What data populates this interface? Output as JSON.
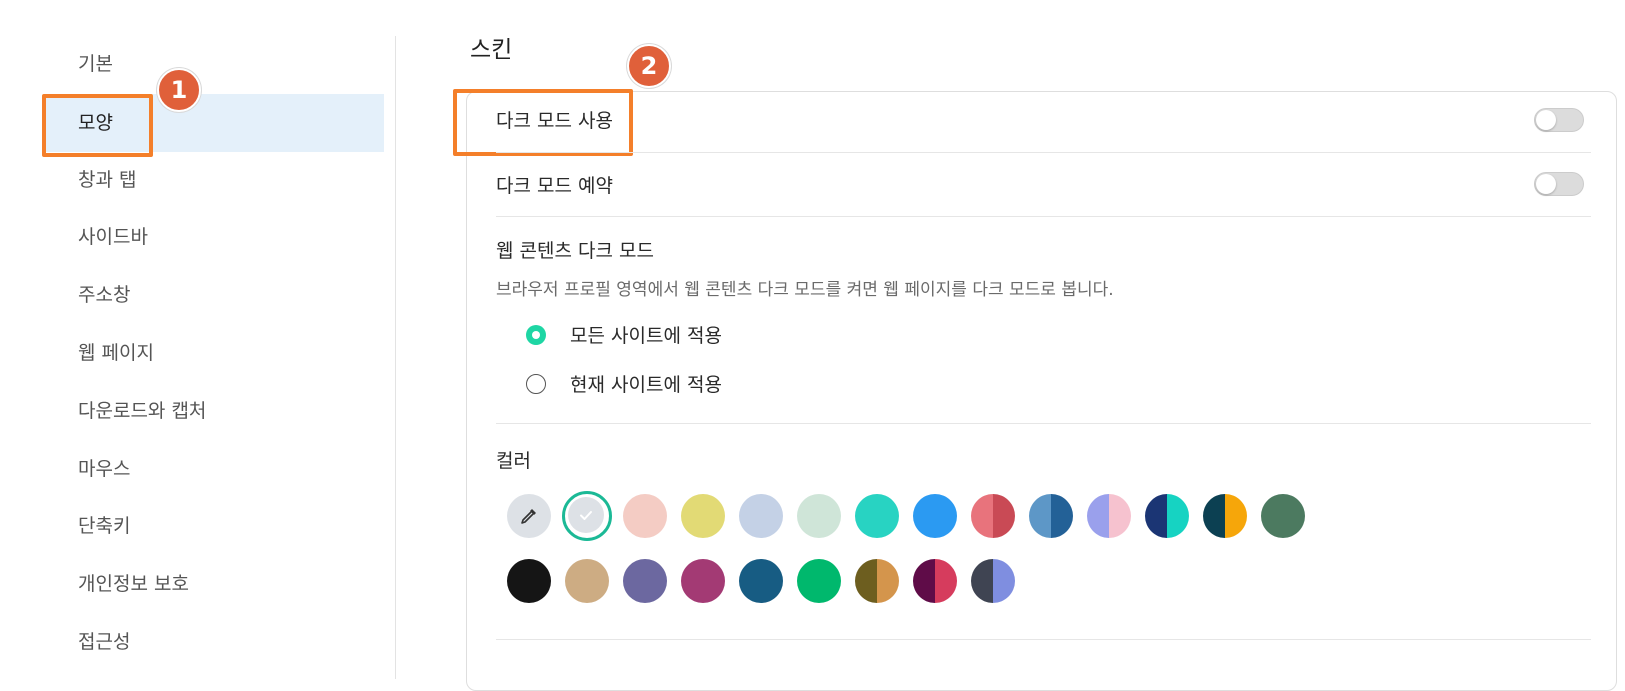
{
  "sidebar": {
    "items": [
      {
        "label": "기본"
      },
      {
        "label": "모양"
      },
      {
        "label": "창과 탭"
      },
      {
        "label": "사이드바"
      },
      {
        "label": "주소창"
      },
      {
        "label": "웹 페이지"
      },
      {
        "label": "다운로드와 캡처"
      },
      {
        "label": "마우스"
      },
      {
        "label": "단축키"
      },
      {
        "label": "개인정보 보호"
      },
      {
        "label": "접근성"
      }
    ],
    "active_index": 1
  },
  "annotations": {
    "badge1": "1",
    "badge2": "2",
    "highlight_color": "#f47f2a",
    "badge_color": "#e0603a"
  },
  "main": {
    "section_title": "스킨",
    "dark_mode_use": {
      "label": "다크 모드 사용",
      "enabled": false
    },
    "dark_mode_schedule": {
      "label": "다크 모드 예약",
      "enabled": false
    },
    "web_content_dark": {
      "title": "웹 콘텐츠 다크 모드",
      "description": "브라우저 프로필 영역에서 웹 콘텐츠 다크 모드를 켜면 웹 페이지를 다크 모드로 봅니다.",
      "options": [
        {
          "label": "모든 사이트에 적용",
          "checked": true
        },
        {
          "label": "현재 사이트에 적용",
          "checked": false
        }
      ]
    },
    "color": {
      "title": "컬러",
      "accent": "#1ed6a4",
      "row1": [
        {
          "type": "picker",
          "color": "#dde1e6",
          "icon": "eyedropper-icon"
        },
        {
          "type": "selected",
          "color": "#dde1e6",
          "icon": "check-icon"
        },
        {
          "color": "#f4ccc4"
        },
        {
          "color": "#e2da75"
        },
        {
          "color": "#c4d1e6"
        },
        {
          "color": "#cfe5d8"
        },
        {
          "color": "#28d3c2"
        },
        {
          "color": "#2b9af2"
        },
        {
          "split": [
            "#e8737c",
            "#c94a55"
          ]
        },
        {
          "split": [
            "#5d97c7",
            "#236197"
          ]
        },
        {
          "split": [
            "#9aa0ec",
            "#f6c2cf"
          ]
        },
        {
          "split": [
            "#1b3574",
            "#16d3c2"
          ]
        },
        {
          "split": [
            "#0c4052",
            "#f6a60a"
          ]
        },
        {
          "color": "#4c7a60"
        }
      ],
      "row2": [
        {
          "color": "#151515"
        },
        {
          "color": "#cdac83"
        },
        {
          "color": "#6c68a0"
        },
        {
          "color": "#a33a74"
        },
        {
          "color": "#175c83"
        },
        {
          "color": "#00b86d"
        },
        {
          "split": [
            "#6d5e1f",
            "#d4954c"
          ]
        },
        {
          "split": [
            "#5f0c48",
            "#d63c5d"
          ]
        },
        {
          "split": [
            "#3f4452",
            "#7f8ee0"
          ]
        }
      ]
    }
  }
}
